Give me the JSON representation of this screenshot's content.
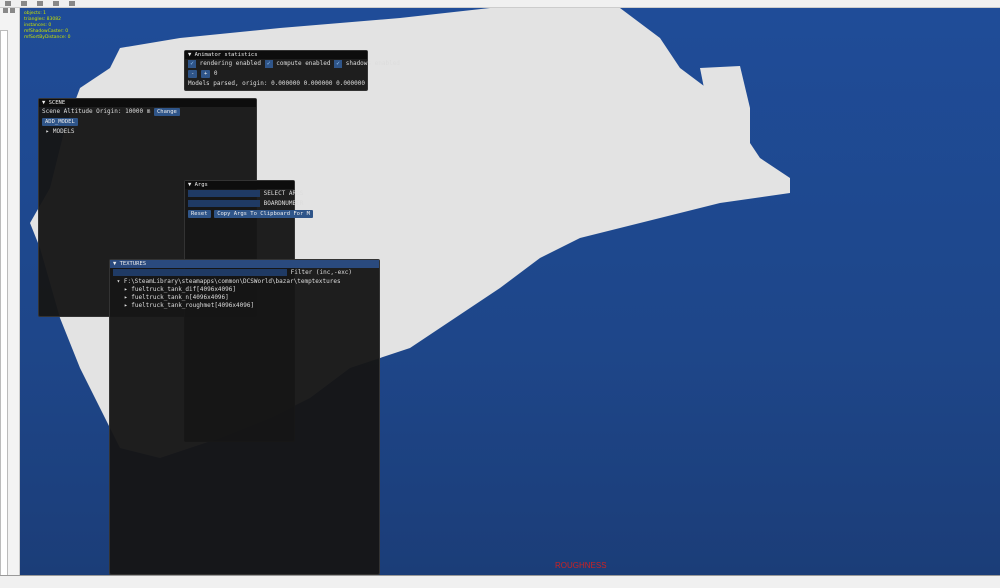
{
  "stats": [
    "objects: 1",
    "triangles: 83082",
    "instances: 0",
    "mfShadowCaster: 0",
    "mfSortByDistance: 0"
  ],
  "animator": {
    "title": "Animator statistics",
    "rendering": "rendering enabled",
    "compute": "compute enabled",
    "shadows": "shadows enabled",
    "minus": "-",
    "plus": "+",
    "count": "0",
    "models_parsed": "Models parsed, origin: 0.000000 0.000000 0.000000"
  },
  "scene": {
    "title": "SCENE",
    "altitude": "Scene Altitude Origin: 10000 m",
    "change": "Change",
    "add_model": "ADD_MODEL",
    "models": "MODELS"
  },
  "args": {
    "title": "Args",
    "select_args": "SELECT ARGS",
    "boardnumber": "BOARDNUMBER",
    "reset": "Reset",
    "copy": "Copy Args To Clipboard For M"
  },
  "textures": {
    "title": "TEXTURES",
    "filter": "Filter (inc,-exc)",
    "path": "F:\\SteamLibrary\\steamapps\\common\\DCSWorld\\bazar\\temptextures",
    "items": [
      "fueltruck_tank_dif[4096x4096]",
      "fueltruck_tank_n[4096x4096]",
      "fueltruck_tank_roughmet[4096x4096]"
    ]
  },
  "overlay": {
    "mode": "ROUGHNESS"
  }
}
